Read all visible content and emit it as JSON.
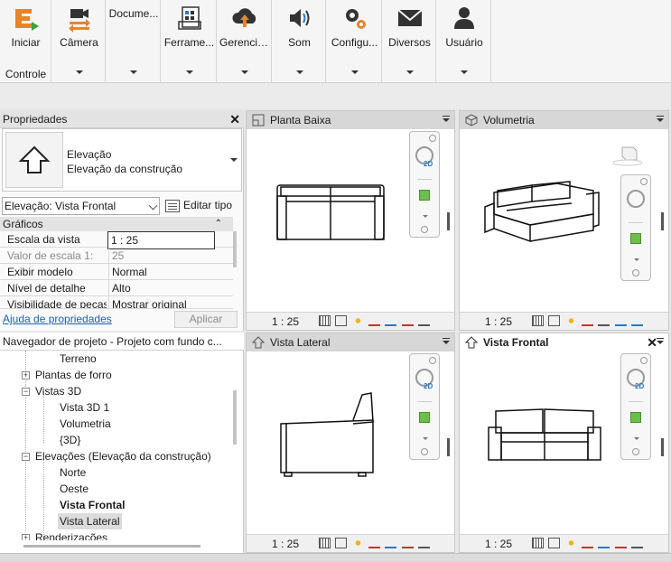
{
  "ribbon": {
    "buttons": [
      {
        "label": "Iniciar",
        "icon": "start-logo-icon"
      },
      {
        "label": "Câmera",
        "icon": "camera-icon"
      },
      {
        "label": "Docume...",
        "icon": "document-icon"
      },
      {
        "label": "Ferrame...",
        "icon": "tools-icon"
      },
      {
        "label": "Gerencia...",
        "icon": "cloud-upload-icon"
      },
      {
        "label": "Som",
        "icon": "speaker-icon"
      },
      {
        "label": "Configu...",
        "icon": "settings-gears-icon"
      },
      {
        "label": "Diversos",
        "icon": "envelope-icon"
      },
      {
        "label": "Usuário",
        "icon": "user-icon"
      }
    ],
    "group_label": "Controle"
  },
  "properties": {
    "title": "Propriedades",
    "type_line1": "Elevação",
    "type_line2": "Elevação da construção",
    "instance_selector": "Elevação: Vista Frontal",
    "edit_type": "Editar tipo",
    "group": "Gráficos",
    "rows": [
      {
        "key": "Escala da vista",
        "value": "1 : 25"
      },
      {
        "key": "Valor de escala    1:",
        "value": "25"
      },
      {
        "key": "Exibir modelo",
        "value": "Normal"
      },
      {
        "key": "Nível de detalhe",
        "value": "Alto"
      },
      {
        "key": "Visibilidade de peças",
        "value": "Mostrar original"
      }
    ],
    "help_link": "Ajuda de propriedades",
    "apply": "Aplicar"
  },
  "browser": {
    "title": "Navegador de projeto - Projeto com fundo c...",
    "items": [
      {
        "label": "Terreno"
      },
      {
        "label": "Plantas de forro"
      },
      {
        "label": "Vistas 3D"
      },
      {
        "label": "Vista 3D 1"
      },
      {
        "label": "Volumetria"
      },
      {
        "label": "{3D}"
      },
      {
        "label": "Elevações (Elevação da construção)"
      },
      {
        "label": "Norte"
      },
      {
        "label": "Oeste"
      },
      {
        "label": "Vista Frontal"
      },
      {
        "label": "Vista Lateral"
      },
      {
        "label": "Renderizações"
      }
    ]
  },
  "views": [
    {
      "title": "Planta Baixa",
      "scale": "1 : 25"
    },
    {
      "title": "Volumetria",
      "scale": "1 : 25"
    },
    {
      "title": "Vista Lateral",
      "scale": "1 : 25"
    },
    {
      "title": "Vista Frontal",
      "scale": "1 : 25"
    }
  ],
  "colors": {
    "accent": "#e8842a",
    "link": "#1a5fb4"
  }
}
